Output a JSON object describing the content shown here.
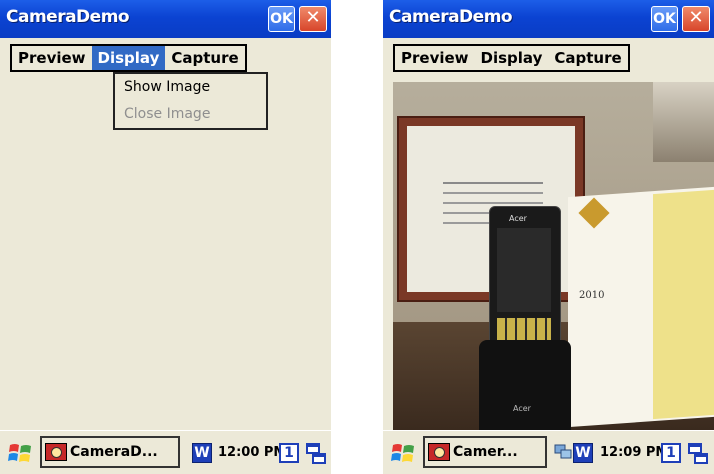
{
  "screens": [
    {
      "title": "CameraDemo",
      "ok_label": "OK",
      "close_label": "✕",
      "menu": [
        {
          "label": "Preview",
          "active": false
        },
        {
          "label": "Display",
          "active": true
        },
        {
          "label": "Capture",
          "active": false
        }
      ],
      "dropdown": [
        {
          "label": "Show Image",
          "enabled": true
        },
        {
          "label": "Close Image",
          "enabled": false
        }
      ],
      "taskbar": {
        "task_label": "CameraD...",
        "w_label": "W",
        "time": "12:00 PM",
        "badge": "1"
      }
    },
    {
      "title": "CameraDemo",
      "ok_label": "OK",
      "close_label": "✕",
      "menu": [
        {
          "label": "Preview",
          "active": false
        },
        {
          "label": "Display",
          "active": false
        },
        {
          "label": "Capture",
          "active": false
        }
      ],
      "photo": {
        "phone_brand": "Acer",
        "phone_brand_bottom": "Acer",
        "doc_year": "2010"
      },
      "taskbar": {
        "task_label": "Camer...",
        "w_label": "W",
        "time": "12:09 PM",
        "badge": "1"
      }
    }
  ],
  "colors": {
    "titlebar": "#0b43d2",
    "menu_highlight": "#316ac5",
    "window_bg": "#ece9d8",
    "close_red": "#d8452a"
  }
}
